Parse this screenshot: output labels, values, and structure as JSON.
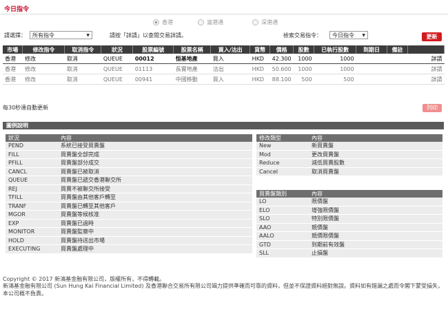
{
  "title": "今日指令",
  "markets": [
    {
      "label": "香港",
      "selected": true
    },
    {
      "label": "滬港通",
      "selected": false
    },
    {
      "label": "深港通",
      "selected": false
    }
  ],
  "filter": {
    "label": "請選擇：",
    "value": "所有指令"
  },
  "hint": "請按「詳請」以查閱交易詳請。",
  "search": {
    "label": "檢索交易指令：",
    "value": "今日指令"
  },
  "refresh_label": "更新",
  "columns": [
    "市場",
    "修改指令",
    "取消指令",
    "狀況",
    "股票編號",
    "股票名稱",
    "買入/沽出",
    "貨幣",
    "價格",
    "股數",
    "已執行股數",
    "到期日",
    "備註",
    ""
  ],
  "orders": [
    {
      "market": "香港",
      "modify": "修改",
      "cancel": "取消",
      "status": "QUEUE",
      "code": "00012",
      "name": "恒基地產",
      "side": "買入",
      "ccy": "HKD",
      "price": "42.300",
      "qty": "1000",
      "filled": "1000",
      "expiry": "",
      "remark": "",
      "detail": "詳請"
    },
    {
      "market": "香港",
      "modify": "修改",
      "cancel": "取消",
      "status": "QUEUE",
      "code": "01113",
      "name": "長實地產",
      "side": "沽出",
      "ccy": "HKD",
      "price": "50.600",
      "qty": "1000",
      "filled": "1000",
      "expiry": "",
      "remark": "",
      "detail": "詳請"
    },
    {
      "market": "香港",
      "modify": "修改",
      "cancel": "取消",
      "status": "QUEUE",
      "code": "00941",
      "name": "中國移動",
      "side": "買入",
      "ccy": "HKD",
      "price": "88.100",
      "qty": "500",
      "filled": "500",
      "expiry": "",
      "remark": "",
      "detail": "詳請"
    }
  ],
  "auto_refresh": "每30秒達自動更新",
  "print_label": "列印",
  "legend_title": "圖例說明",
  "status_legend": {
    "headers": [
      "狀況",
      "內容"
    ],
    "rows": [
      [
        "PEND",
        "系統已接受買賣盤"
      ],
      [
        "FILL",
        "買賣盤全部完成"
      ],
      [
        "PFILL",
        "買賣盤部分成交"
      ],
      [
        "CANCL",
        "買賣盤已被取消"
      ],
      [
        "QUEUE",
        "買賣盤已遞交香港聯交所"
      ],
      [
        "REJ",
        "買賣不被聯交所接受"
      ],
      [
        "TFILL",
        "買賣盤由其他客戶轉至"
      ],
      [
        "TRANF",
        "買賣盤已轉至其他客戶"
      ],
      [
        "MGOR",
        "買賣盤等候核准"
      ],
      [
        "EXP",
        "買賣盤已過時"
      ],
      [
        "MONITOR",
        "買賣盤監察中"
      ],
      [
        "HOLD",
        "買賣盤待送出市場"
      ],
      [
        "EXECUTING",
        "買賣盤處理中"
      ]
    ]
  },
  "modify_legend": {
    "headers": [
      "修改類型",
      "內容"
    ],
    "rows": [
      [
        "New",
        "新買賣盤"
      ],
      [
        "Mod",
        "更改買賣盤"
      ],
      [
        "Reduce",
        "減低買賣股數"
      ],
      [
        "Cancel",
        "取消買賣盤"
      ]
    ]
  },
  "type_legend": {
    "headers": [
      "買賣盤類別",
      "內容"
    ],
    "rows": [
      [
        "LO",
        "限價盤"
      ],
      [
        "ELO",
        "增強限價盤"
      ],
      [
        "SLO",
        "特別限價盤"
      ],
      [
        "AAO",
        "競價盤"
      ],
      [
        "AALO",
        "競價限價盤"
      ],
      [
        "GTD",
        "到期前有效盤"
      ],
      [
        "SLL",
        "止損盤"
      ]
    ]
  },
  "footer": {
    "copyright": "Copyright © 2017 新鴻基金融有限公司，版權所有，不得轉載。",
    "disclaimer": "新鴻基金融有限公司 (Sun Hung Kai Financial Limited) 及香港聯合交易所有限公司竭力提供準確而可靠的資料，但並不保證資料絕對無誤。資料如有錯漏之處而令閣下蒙受損失，本公司概不負責。"
  }
}
